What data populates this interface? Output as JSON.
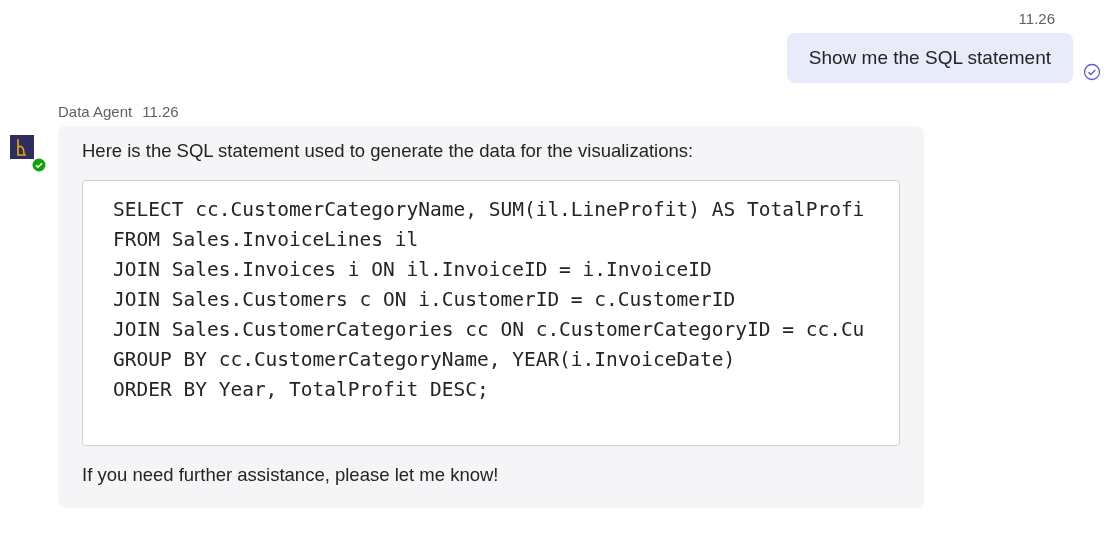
{
  "messages": [
    {
      "kind": "user",
      "time": "11.26",
      "text": "Show me the SQL statement",
      "read": true
    },
    {
      "kind": "agent",
      "sender": "Data Agent",
      "time": "11.26",
      "online": true,
      "intro": "Here is the SQL statement used to generate the data for the visualizations:",
      "code_lines": [
        "SELECT cc.CustomerCategoryName, SUM(il.LineProfit) AS TotalProfi",
        "FROM Sales.InvoiceLines il",
        "JOIN Sales.Invoices i ON il.InvoiceID = i.InvoiceID",
        "JOIN Sales.Customers c ON i.CustomerID = c.CustomerID",
        "JOIN Sales.CustomerCategories cc ON c.CustomerCategoryID = cc.Cu",
        "GROUP BY cc.CustomerCategoryName, YEAR(i.InvoiceDate)",
        "ORDER BY Year, TotalProfit DESC;"
      ],
      "outro": "If you need further assistance, please let me know!"
    }
  ]
}
